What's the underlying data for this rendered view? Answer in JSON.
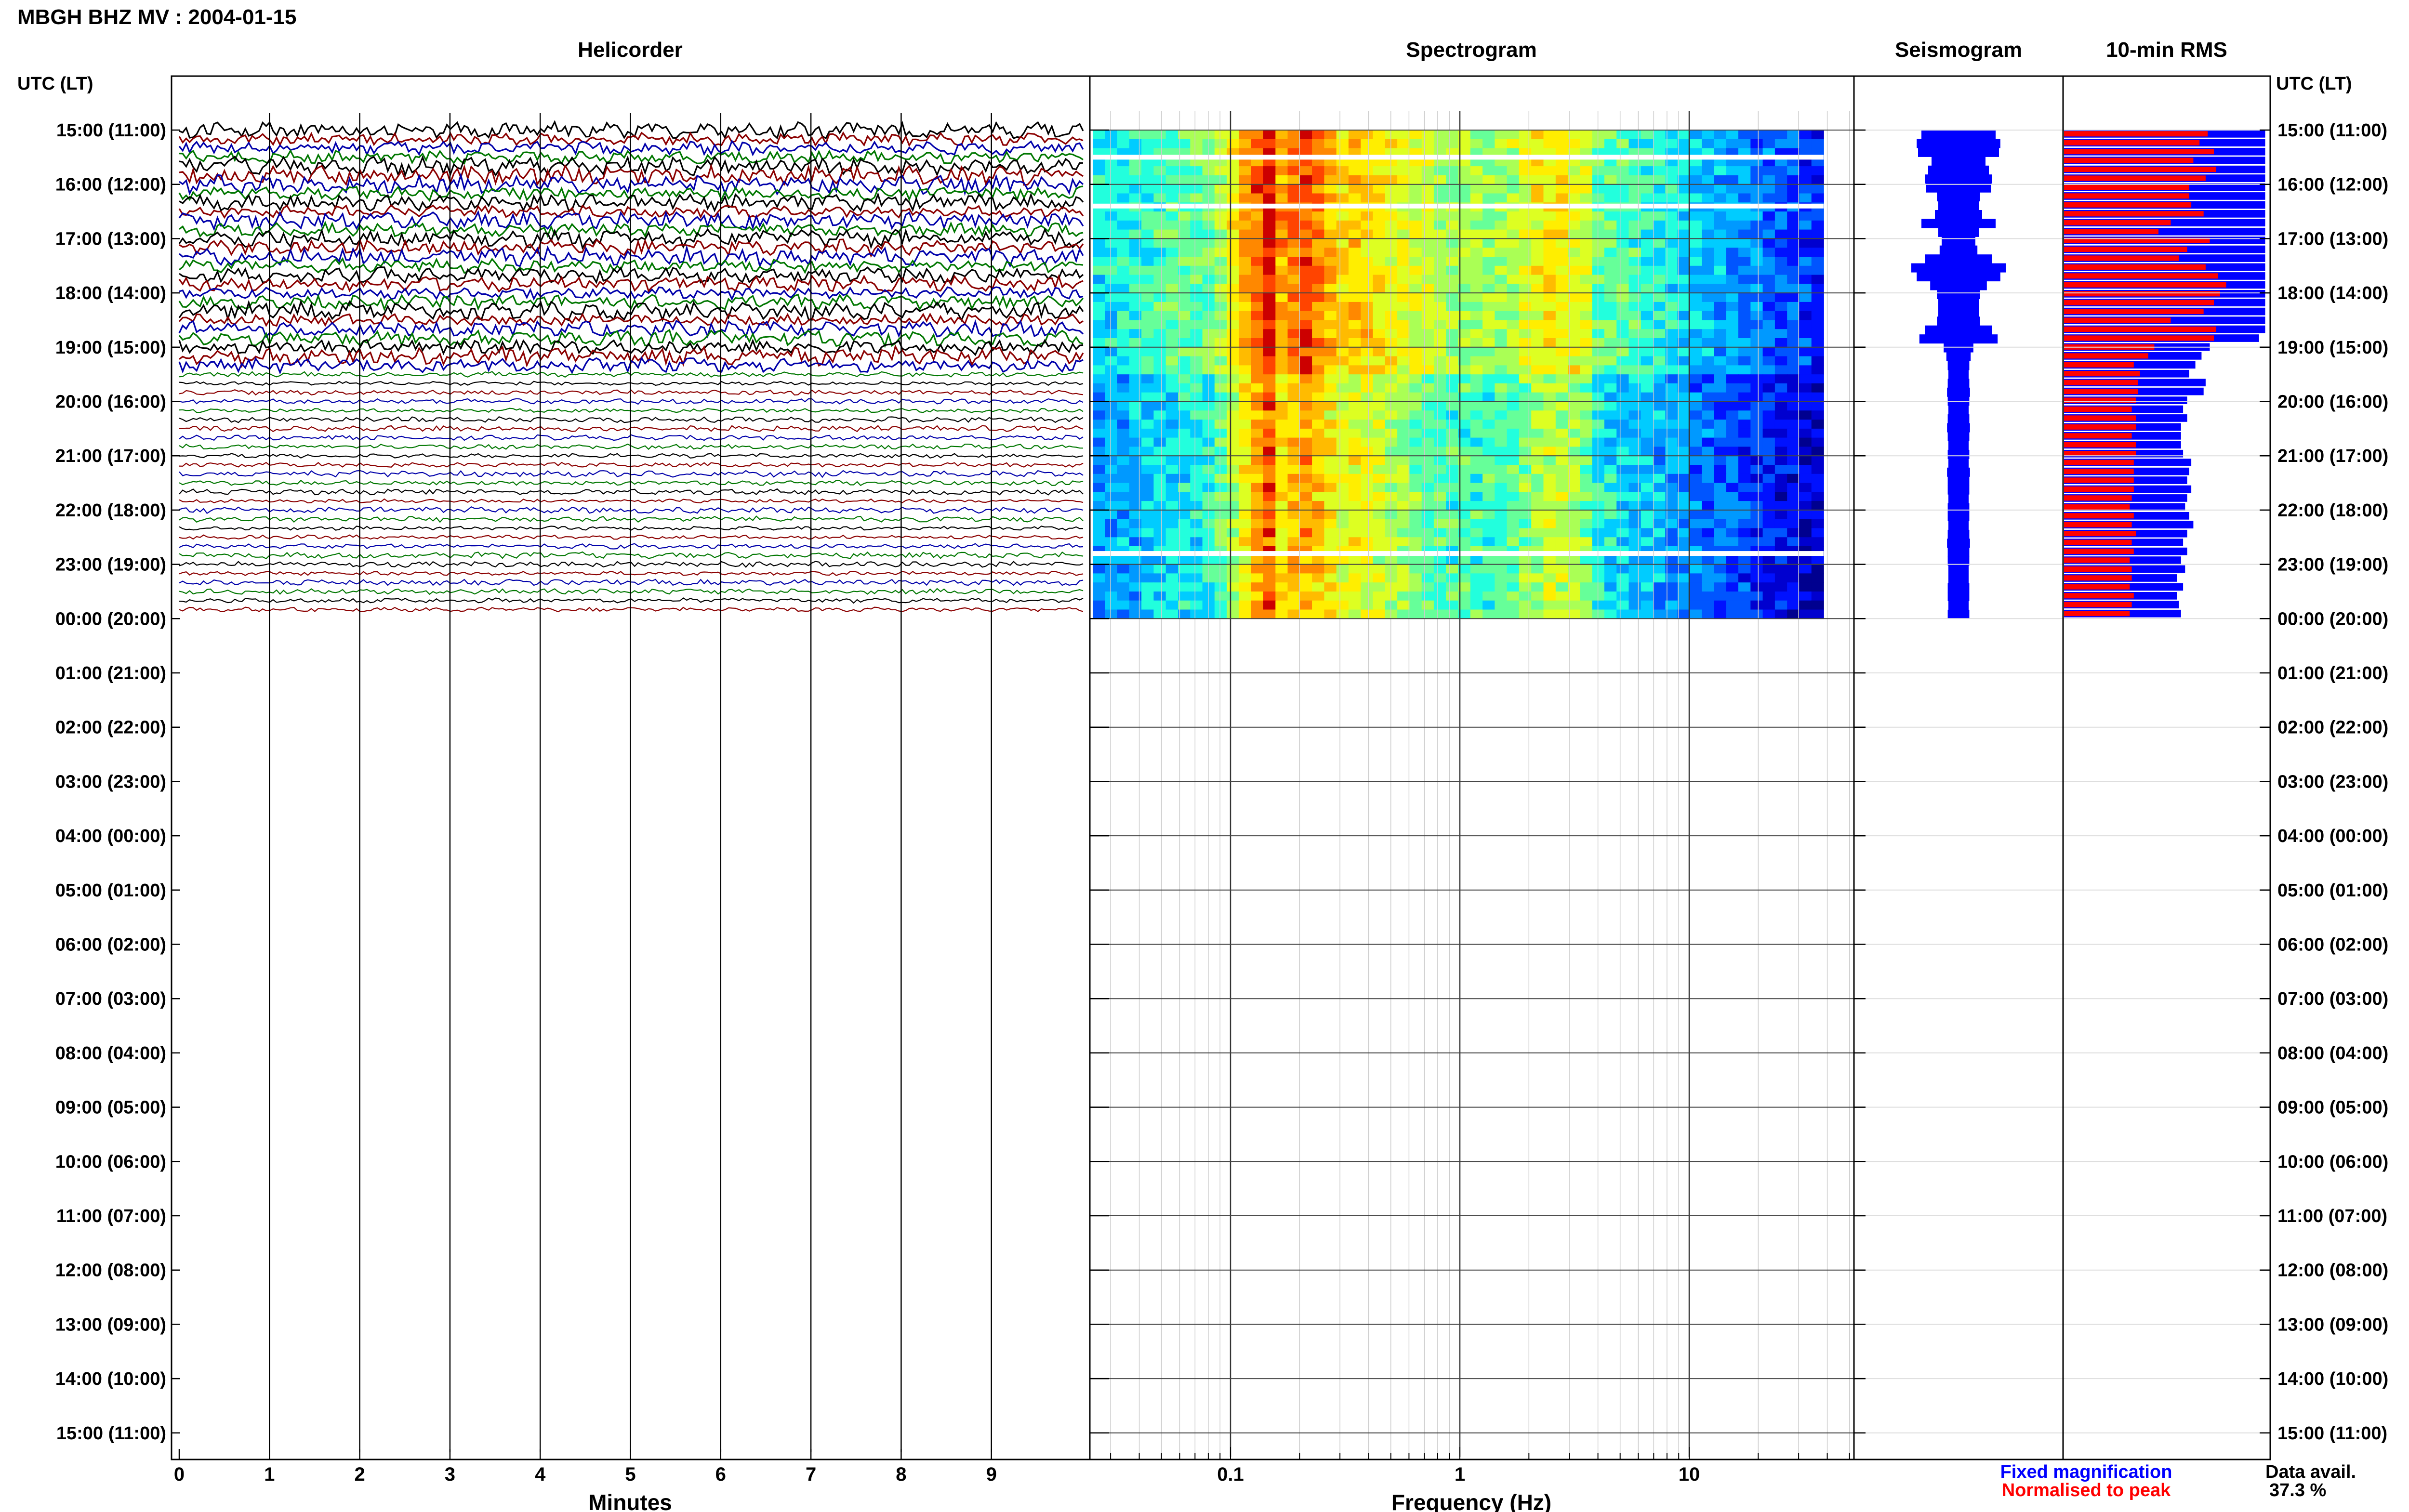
{
  "header": {
    "title": "MBGH BHZ MV : 2004-01-15"
  },
  "panels": {
    "helicorder": "Helicorder",
    "spectrogram": "Spectrogram",
    "seismogram": "Seismogram",
    "rms": "10-min RMS"
  },
  "axes": {
    "utc_label_left": "UTC (LT)",
    "utc_label_right": "UTC (LT)",
    "minutes_label": "Minutes",
    "frequency_label": "Frequency (Hz)",
    "minute_ticks": [
      "0",
      "1",
      "2",
      "3",
      "4",
      "5",
      "6",
      "7",
      "8",
      "9"
    ],
    "frequency_ticks": [
      "0.1",
      "1",
      "10"
    ],
    "time_rows": [
      "15:00 (11:00)",
      "16:00 (12:00)",
      "17:00 (13:00)",
      "18:00 (14:00)",
      "19:00 (15:00)",
      "20:00 (16:00)",
      "21:00 (17:00)",
      "22:00 (18:00)",
      "23:00 (19:00)",
      "00:00 (20:00)",
      "01:00 (21:00)",
      "02:00 (22:00)",
      "03:00 (23:00)",
      "04:00 (00:00)",
      "05:00 (01:00)",
      "06:00 (02:00)",
      "07:00 (03:00)",
      "08:00 (04:00)",
      "09:00 (05:00)",
      "10:00 (06:00)",
      "11:00 (07:00)",
      "12:00 (08:00)",
      "13:00 (09:00)",
      "14:00 (10:00)",
      "15:00 (11:00)"
    ]
  },
  "legend": {
    "fixed": "Fixed magnification",
    "normalised": "Normalised to peak",
    "fixed_color": "#0000ff",
    "normalised_color": "#ff0000"
  },
  "data_avail": {
    "label": "Data avail.",
    "value": "37.3 %"
  },
  "chart_data": {
    "type": "heatmap",
    "station": "MBGH BHZ MV",
    "date": "2004-01-15",
    "hours_with_data": 9,
    "helicorder_colors": [
      "#000000",
      "#8b0000",
      "#0000aa",
      "#007700"
    ],
    "rms_fixed": [
      0.98,
      0.98,
      0.98,
      0.98,
      0.98,
      0.98,
      0.98,
      0.98,
      0.98,
      0.98,
      0.98,
      0.98,
      0.98,
      0.98,
      0.98,
      0.98,
      0.98,
      0.98,
      0.98,
      0.98,
      0.98,
      0.98,
      0.98,
      0.95,
      0.71,
      0.67,
      0.64,
      0.61,
      0.69,
      0.68,
      0.6,
      0.58,
      0.6,
      0.57,
      0.57,
      0.57,
      0.58,
      0.62,
      0.61,
      0.6,
      0.62,
      0.6,
      0.59,
      0.61,
      0.63,
      0.6,
      0.58,
      0.6,
      0.57,
      0.59,
      0.55,
      0.58,
      0.55,
      0.56,
      0.57
    ],
    "rms_normalised": [
      0.7,
      0.66,
      0.73,
      0.63,
      0.74,
      0.69,
      0.61,
      0.61,
      0.62,
      0.68,
      0.52,
      0.46,
      0.71,
      0.6,
      0.56,
      0.69,
      0.75,
      0.79,
      0.76,
      0.73,
      0.68,
      0.52,
      0.74,
      0.73,
      0.44,
      0.41,
      0.34,
      0.37,
      0.36,
      0.36,
      0.35,
      0.33,
      0.35,
      0.35,
      0.33,
      0.35,
      0.35,
      0.34,
      0.34,
      0.34,
      0.34,
      0.33,
      0.32,
      0.34,
      0.33,
      0.35,
      0.33,
      0.34,
      0.32,
      0.33,
      0.33,
      0.32,
      0.34,
      0.33,
      0.32
    ],
    "seismogram_amplitude": [
      0.55,
      0.62,
      0.6,
      0.4,
      0.45,
      0.5,
      0.48,
      0.32,
      0.3,
      0.35,
      0.55,
      0.3,
      0.25,
      0.28,
      0.5,
      0.7,
      0.62,
      0.42,
      0.32,
      0.3,
      0.3,
      0.32,
      0.5,
      0.58,
      0.22,
      0.18,
      0.16,
      0.15,
      0.16,
      0.17,
      0.16,
      0.15,
      0.16,
      0.17,
      0.16,
      0.15,
      0.16,
      0.15,
      0.17,
      0.16,
      0.16,
      0.15,
      0.16,
      0.16,
      0.15,
      0.16,
      0.17,
      0.16,
      0.16,
      0.15,
      0.15,
      0.16,
      0.16,
      0.15,
      0.16
    ],
    "spectrogram_gaps": [
      0.5,
      1.4,
      7.8
    ]
  }
}
